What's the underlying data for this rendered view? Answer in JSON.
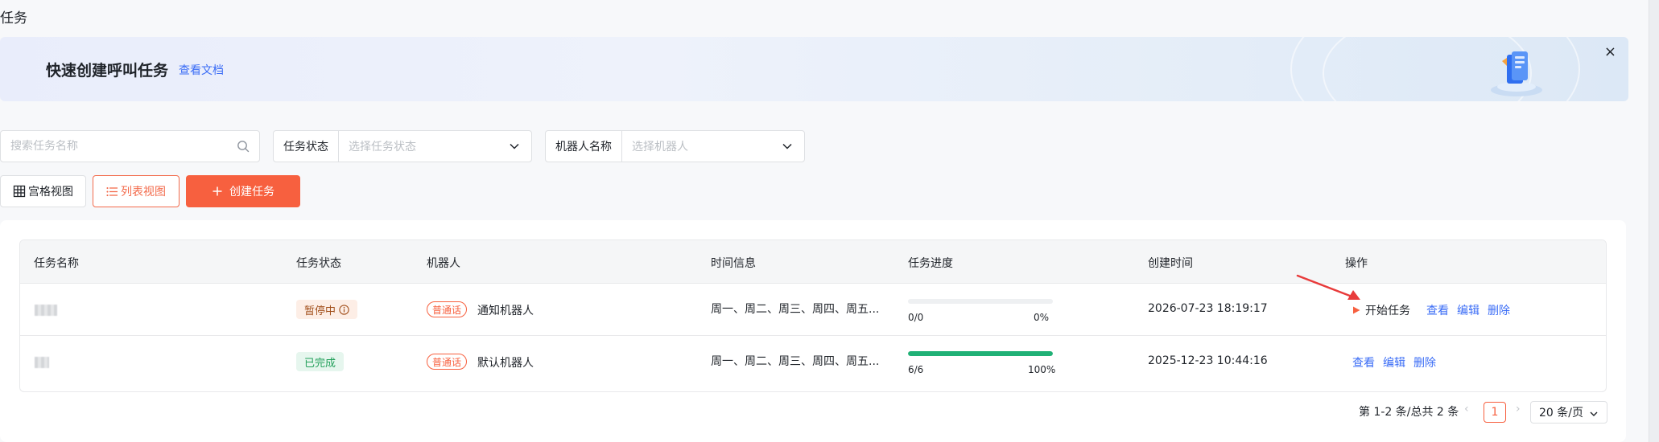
{
  "page": {
    "title": "任务"
  },
  "banner": {
    "title": "快速创建呼叫任务",
    "doc_link": "查看文档",
    "close": "×"
  },
  "filters": {
    "search_placeholder": "搜索任务名称",
    "status_label": "任务状态",
    "status_placeholder": "选择任务状态",
    "robot_label": "机器人名称",
    "robot_placeholder": "选择机器人"
  },
  "toolbar": {
    "grid_view": "宫格视图",
    "list_view": "列表视图",
    "create_task": "创建任务"
  },
  "table": {
    "headers": [
      "任务名称",
      "任务状态",
      "机器人",
      "时间信息",
      "任务进度",
      "创建时间",
      "操作"
    ],
    "rows": [
      {
        "status": "暂停中",
        "robot_tag": "普通话",
        "robot": "通知机器人",
        "time_info": "周一、周二、周三、周四、周五...",
        "progress_count": "0/0",
        "progress_pct": "0%",
        "progress_fraction": 0,
        "created": "2026-07-23 18:19:17",
        "actions": {
          "start": "开始任务",
          "view": "查看",
          "edit": "编辑",
          "delete": "删除"
        }
      },
      {
        "status": "已完成",
        "robot_tag": "普通话",
        "robot": "默认机器人",
        "time_info": "周一、周二、周三、周四、周五...",
        "progress_count": "6/6",
        "progress_pct": "100%",
        "progress_fraction": 1,
        "created": "2025-12-23 10:44:16",
        "actions": {
          "view": "查看",
          "edit": "编辑",
          "delete": "删除"
        }
      }
    ]
  },
  "pagination": {
    "total_text": "第 1-2 条/总共 2 条",
    "prev": "‹",
    "current_page": "1",
    "next": "›",
    "page_size": "20 条/页"
  },
  "colors": {
    "accent": "#f7603f",
    "link": "#3a6cf6",
    "success": "#20b176"
  }
}
